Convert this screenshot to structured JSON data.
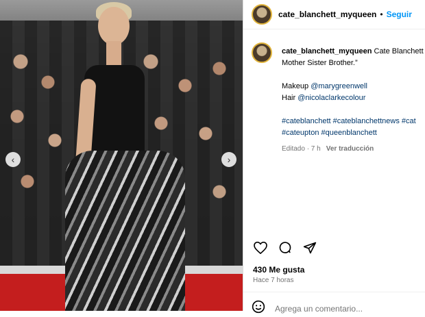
{
  "post": {
    "username": "cate_blanchett_myqueen",
    "dot": "•",
    "follow_label": "Seguir",
    "caption_line1": "Cate Blanchett",
    "caption_line2": "Mother Sister Brother.”",
    "makeup_label": "Makeup",
    "makeup_tag": "@marygreenwell",
    "hair_label": "Hair",
    "hair_tag": "@nicolaclarkecolour",
    "hashtags_line1": "#cateblanchett #cateblanchettnews #cat",
    "hashtags_line2": "#cateupton #queenblanchett",
    "edited": "Editado · 7 h",
    "see_translation": "Ver traducción",
    "likes": "430 Me gusta",
    "time_ago": "Hace 7 horas",
    "comment_placeholder": "Agrega un comentario..."
  },
  "icons": {
    "prev": "chevron-left-icon",
    "next": "chevron-right-icon",
    "like": "heart-icon",
    "comment": "comment-icon",
    "share": "share-icon",
    "emoji": "emoji-icon"
  },
  "colors": {
    "link": "#0095f6",
    "tag": "#00376b",
    "muted": "#737373",
    "carpet": "#c41e1e"
  }
}
